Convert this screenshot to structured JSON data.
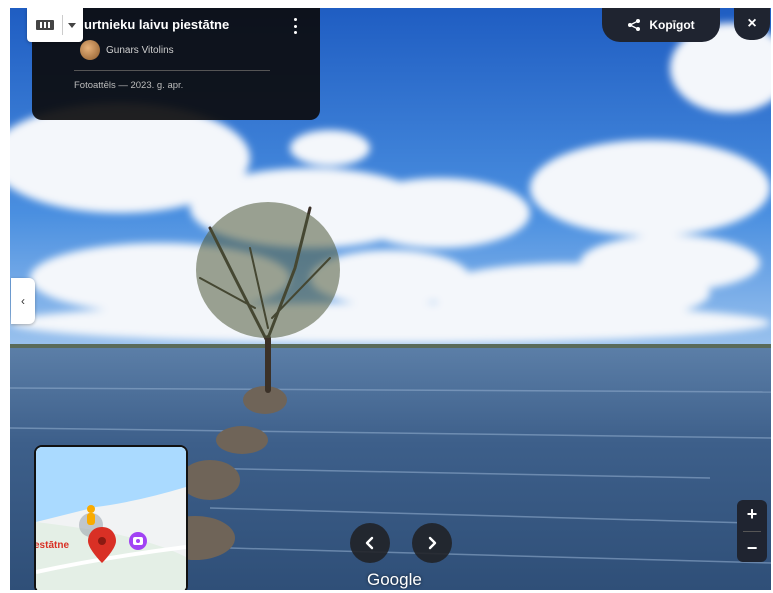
{
  "info_card": {
    "title": "urtnieku laivu piestātne",
    "author": "Gunars Vitolins",
    "date": "Fotoattēls — 2023. g. apr."
  },
  "share": {
    "label": "Kopīgot"
  },
  "close": {
    "label": "×"
  },
  "minimap": {
    "place_label": "estātne"
  },
  "google_logo": "Google",
  "zoom": {
    "in": "+",
    "out": "−"
  },
  "side_tab": {
    "icon": "‹"
  },
  "icons": [
    "layers-icon",
    "more-vert-icon",
    "share-icon",
    "close-icon",
    "chevron-left-icon",
    "arrow-left-icon",
    "arrow-right-icon",
    "pegman-icon",
    "map-pin-icon",
    "photo-icon"
  ],
  "colors": {
    "panel": "#1f2430",
    "pin": "#d93025",
    "sky": "#2f6fcf",
    "water": "#3a5f8c"
  }
}
